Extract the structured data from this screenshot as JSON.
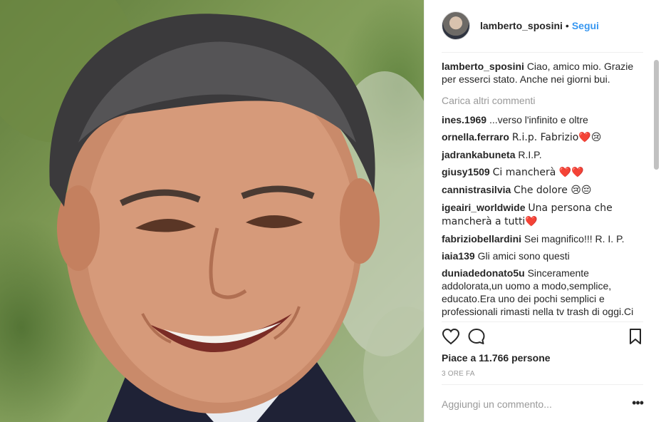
{
  "post": {
    "author": "lamberto_sposini",
    "follow_label": "Segui",
    "separator": "•",
    "caption_user": "lamberto_sposini",
    "caption_text": "Ciao, amico mio. Grazie per esserci stato. Anche nei giorni bui.",
    "load_more": "Carica altri commenti",
    "comments": [
      {
        "user": "ines.1969",
        "text": "...verso l'infinito e oltre"
      },
      {
        "user": "ornella.ferraro",
        "text": "R.i.p. Fabrizio❤️😢"
      },
      {
        "user": "jadrankabuneta",
        "text": "R.I.P."
      },
      {
        "user": "giusy1509",
        "text": "Ci mancherà ❤️❤️"
      },
      {
        "user": "cannistrasilvia",
        "text": "Che dolore 😢😔"
      },
      {
        "user": "igeairi_worldwide",
        "text": "Una persona che mancherà a tutti❤️"
      },
      {
        "user": "fabriziobellardini",
        "text": "Sei magnifico!!! R. I. P."
      },
      {
        "user": "iaia139",
        "text": "Gli amici sono questi"
      },
      {
        "user": "duniadedonato5u",
        "text": "Sinceramente addolorata,un uomo a modo,semplice, educato.Era uno dei pochi semplici e professionali rimasti nella tv trash di oggi.Ci mancherà"
      }
    ],
    "likes": "Piace a 11.766 persone",
    "time_ago": "3 ORE FA",
    "add_comment_placeholder": "Aggiungi un commento...",
    "more_options": "•••"
  },
  "icons": {
    "like": "heart-icon",
    "comment": "comment-bubble-icon",
    "save": "bookmark-icon",
    "options": "more-options-icon"
  },
  "colors": {
    "link_blue": "#3897f0",
    "text": "#262626",
    "muted": "#999999",
    "divider": "#efefef"
  }
}
